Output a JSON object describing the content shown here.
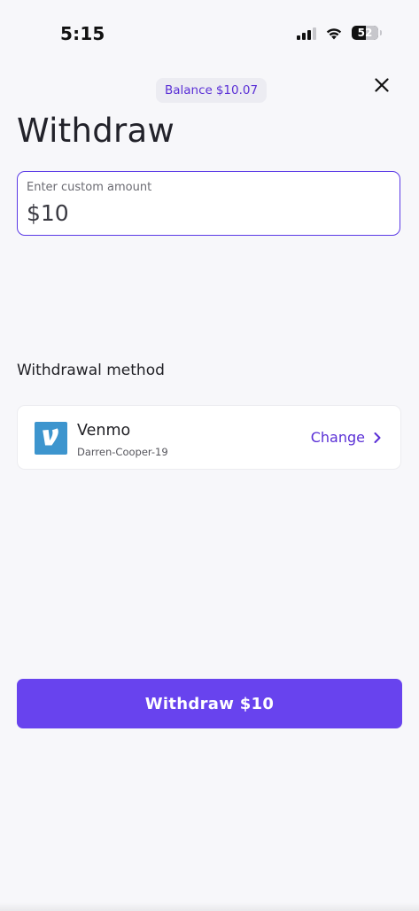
{
  "status_bar": {
    "time": "5:15",
    "battery_level": "52"
  },
  "header": {
    "balance_label": "Balance",
    "balance_amount": "$10.07",
    "title": "Withdraw"
  },
  "amount_field": {
    "label": "Enter custom amount",
    "value": "$10"
  },
  "withdrawal_method": {
    "section_label": "Withdrawal method",
    "name": "Venmo",
    "handle": "Darren-Cooper-19",
    "change_label": "Change",
    "logo_letter": "V"
  },
  "action": {
    "withdraw_label": "Withdraw $10"
  },
  "colors": {
    "accent": "#6843ee",
    "accent_text": "#5a2fd6",
    "venmo_brand": "#3d95ce",
    "background": "#f7f7fa"
  }
}
